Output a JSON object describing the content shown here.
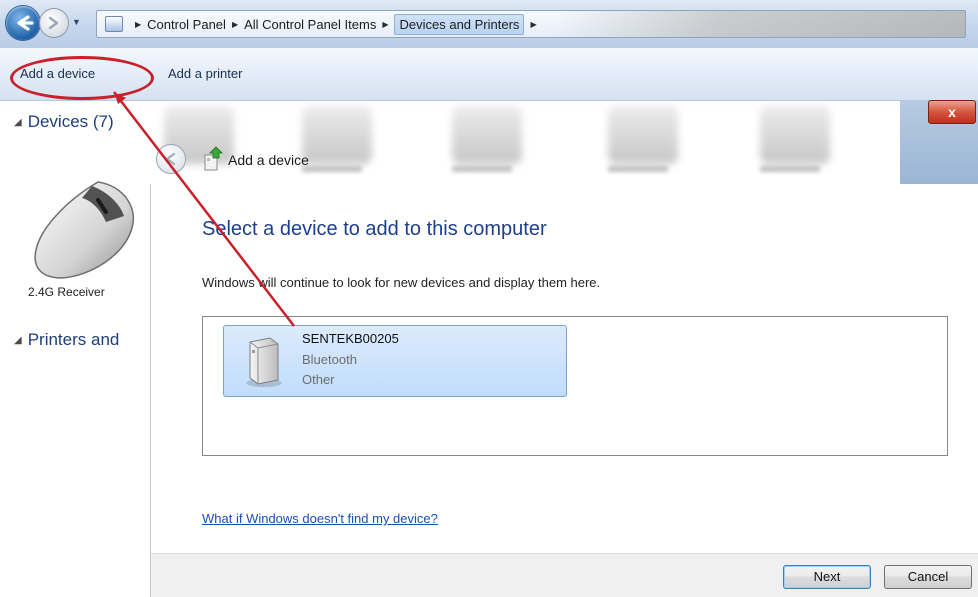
{
  "address_bar": {
    "breadcrumbs": [
      "Control Panel",
      "All Control Panel Items",
      "Devices and Printers"
    ]
  },
  "command_bar": {
    "add_device": "Add a device",
    "add_printer": "Add a printer"
  },
  "explorer": {
    "devices_group": "Devices (7)",
    "printers_group": "Printers and",
    "visible_device_label": "2.4G Receiver"
  },
  "dialog": {
    "window_title": "Add a device",
    "heading": "Select a device to add to this computer",
    "instruction": "Windows will continue to look for new devices and display them here.",
    "devices": [
      {
        "name": "SENTEKB00205",
        "connection": "Bluetooth",
        "category": "Other"
      }
    ],
    "help_link": "What if Windows doesn't find my device?",
    "next_label": "Next",
    "cancel_label": "Cancel",
    "close_glyph": "x"
  },
  "annotation": {
    "highlight_color": "#c9202a"
  },
  "icons": {
    "back": "back-arrow-icon",
    "forward": "forward-arrow-icon",
    "control_panel": "control-panel-icon",
    "mouse": "mouse-icon",
    "device": "generic-device-icon",
    "wizard": "add-device-wizard-icon"
  }
}
